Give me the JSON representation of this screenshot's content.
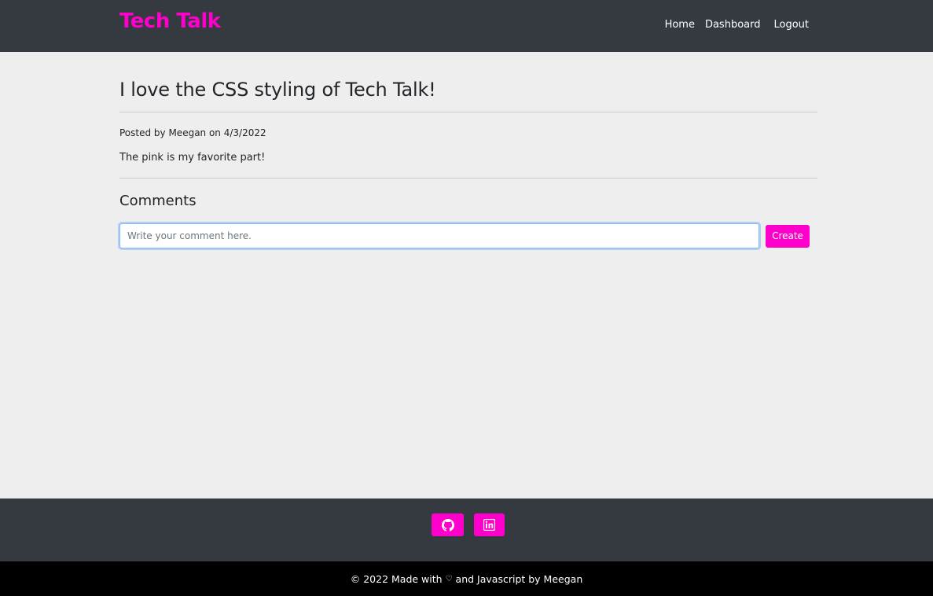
{
  "nav": {
    "brand": "Tech Talk",
    "links": [
      "Home",
      "Dashboard",
      "Logout"
    ]
  },
  "post": {
    "title": "I love the CSS styling of Tech Talk!",
    "meta": "Posted by Meegan on 4/3/2022",
    "body": "The pink is my favorite part!"
  },
  "comments": {
    "heading": "Comments",
    "placeholder": "Write your comment here.",
    "create_label": "Create"
  },
  "footer": {
    "social_icons": [
      "github-icon",
      "linkedin-icon"
    ],
    "copyright_prefix": "© 2022 Made with",
    "heart": "♡",
    "copyright_suffix": "and Javascript by Meegan"
  },
  "colors": {
    "accent": "#ff00cc",
    "navbar": "#343a40",
    "background": "#eeeeee",
    "bottom_bar": "#000000"
  }
}
